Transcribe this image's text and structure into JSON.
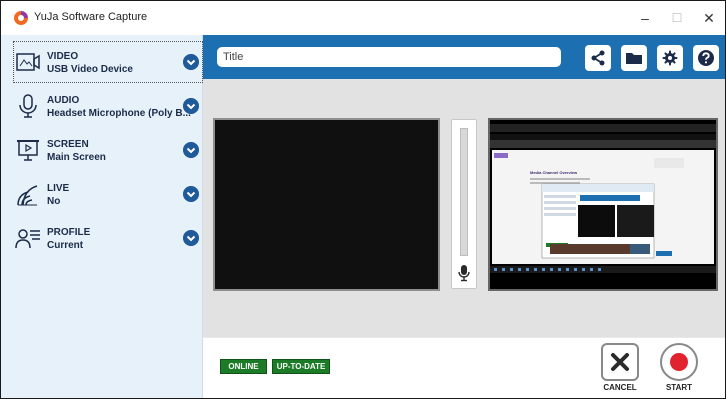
{
  "window": {
    "title": "YuJa Software Capture",
    "minimize_glyph": "–",
    "maximize_glyph": "☐",
    "close_glyph": "✕"
  },
  "sidebar": {
    "items": [
      {
        "title": "VIDEO",
        "value": "USB Video Device",
        "icon": "video-camera-icon",
        "selected": true
      },
      {
        "title": "AUDIO",
        "value": "Headset Microphone (Poly B...",
        "icon": "microphone-icon",
        "selected": false
      },
      {
        "title": "SCREEN",
        "value": "Main Screen",
        "icon": "screen-icon",
        "selected": false
      },
      {
        "title": "LIVE",
        "value": "No",
        "icon": "live-broadcast-icon",
        "selected": false
      },
      {
        "title": "PROFILE",
        "value": "Current",
        "icon": "profile-icon",
        "selected": false
      }
    ]
  },
  "toolbar": {
    "title_placeholder": "Title",
    "title_value": "",
    "buttons": [
      "share-icon",
      "folder-icon",
      "gear-icon",
      "help-icon"
    ]
  },
  "status": {
    "online": "ONLINE",
    "up_to_date": "UP-TO-DATE"
  },
  "actions": {
    "cancel": "CANCEL",
    "start": "START"
  },
  "screen_preview": {
    "heading": "Media Channel Overview"
  },
  "colors": {
    "toolbar": "#1c6fb0",
    "sidebar": "#e6f1f9",
    "chevron": "#1f5a9a",
    "badge": "#1b7b27",
    "record": "#e0232e"
  }
}
